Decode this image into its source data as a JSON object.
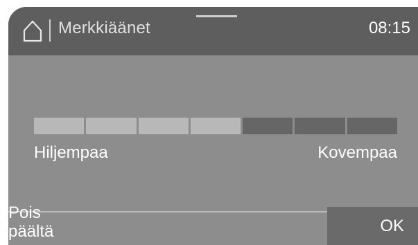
{
  "header": {
    "home_icon": "home-icon",
    "title": "Merkkiäänet",
    "time": "08:15"
  },
  "volume": {
    "level": 4,
    "max": 7
  },
  "labels": {
    "left": "Hiljempaa",
    "right": "Kovempaa"
  },
  "buttons": {
    "off_line1": "Pois",
    "off_line2": "päältä",
    "ok": "OK"
  },
  "colors": {
    "background": "#8d8d8d",
    "header": "#5e5e5e",
    "segment_on": "#b8b8b8",
    "segment_off": "#666666",
    "text": "#ffffff"
  }
}
